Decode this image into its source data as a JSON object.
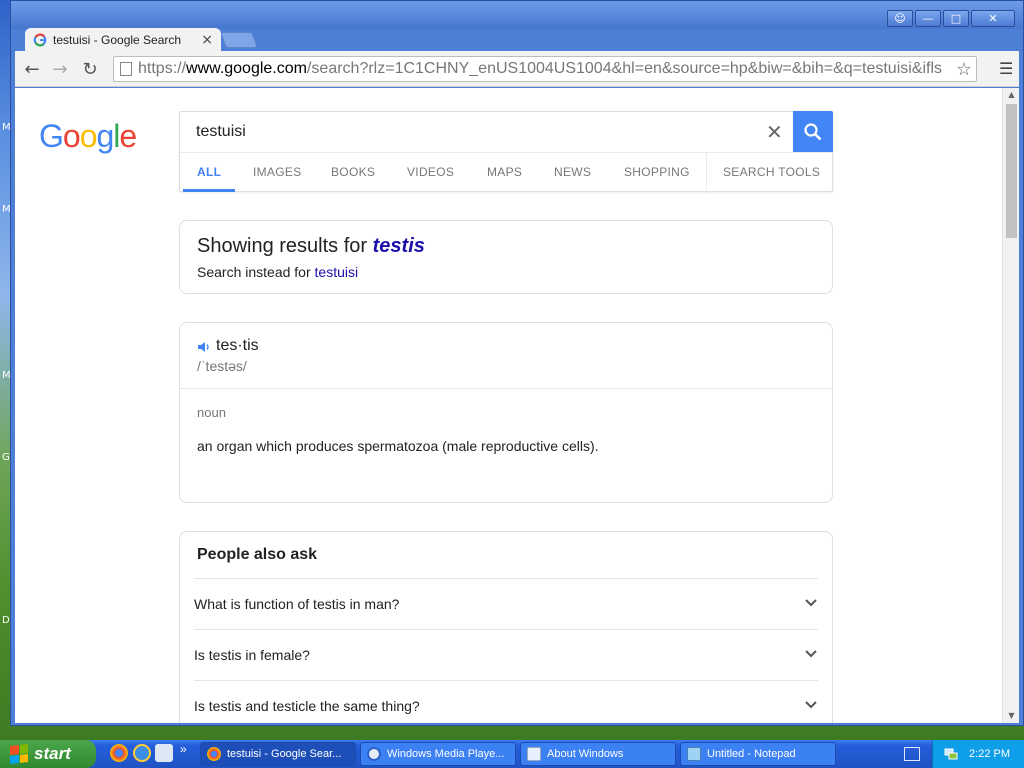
{
  "desktop": {
    "icon_letters": [
      "M",
      "M",
      "M",
      "G",
      "D"
    ]
  },
  "window": {
    "title_buttons": [
      "☺",
      "—",
      "□",
      "✕"
    ],
    "tab": {
      "title": "testuisi - Google Search",
      "close": "×"
    },
    "address": {
      "scheme": "https://",
      "host": "www.google.com",
      "rest": "/search?rlz=1C1CHNY_enUS1004US1004&hl=en&source=hp&biw=&bih=&q=testuisi&ifls"
    }
  },
  "search": {
    "query": "testuisi",
    "tabs": [
      "ALL",
      "IMAGES",
      "BOOKS",
      "VIDEOS",
      "MAPS",
      "NEWS",
      "SHOPPING",
      "SEARCH TOOLS"
    ],
    "active_tab": "ALL"
  },
  "spelling": {
    "showing_prefix": "Showing results for",
    "corrected": "testis",
    "instead_prefix": "Search instead for",
    "original": "testuisi"
  },
  "dictionary": {
    "word": "tes·tis",
    "phonetic": "/ˈtestəs/",
    "part_of_speech": "noun",
    "definition": "an organ which produces spermatozoa (male reproductive cells)."
  },
  "people_also_ask": {
    "title": "People also ask",
    "questions": [
      "What is function of testis in man?",
      "Is testis in female?",
      "Is testis and testicle the same thing?"
    ]
  },
  "taskbar": {
    "start_label": "start",
    "chevron": "»",
    "items": [
      {
        "label": "testuisi - Google Sear...",
        "active": true
      },
      {
        "label": "Windows Media Playe...",
        "active": false
      },
      {
        "label": "About Windows",
        "active": false
      },
      {
        "label": "Untitled - Notepad",
        "active": false
      }
    ],
    "clock": "2:22 PM"
  },
  "colors": {
    "google_blue": "#4285f4",
    "google_red": "#ea4335",
    "google_yellow": "#fbbc05",
    "google_green": "#34a853",
    "link": "#1a0dab"
  }
}
